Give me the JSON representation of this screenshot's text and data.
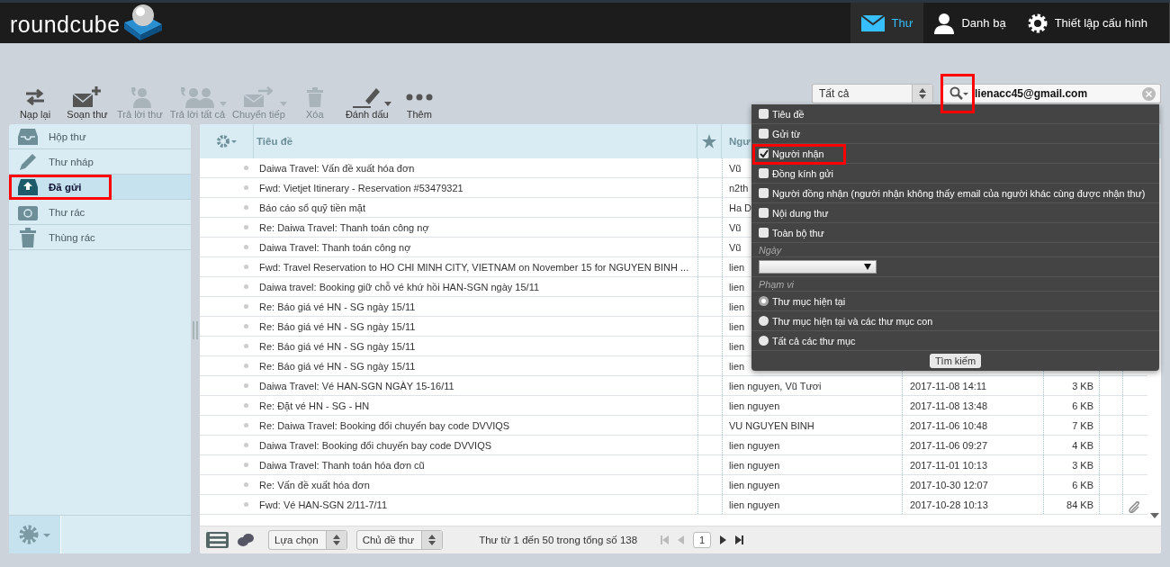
{
  "header": {
    "logo": "roundcube",
    "nav": [
      {
        "label": "Thư",
        "kind": "mail",
        "selected": true
      },
      {
        "label": "Danh bạ",
        "kind": "person",
        "selected": false
      },
      {
        "label": "Thiết lập cấu hình",
        "kind": "gear",
        "selected": false
      }
    ]
  },
  "toolbar": [
    {
      "label": "Nạp lại",
      "kind": "refresh",
      "disabled": false,
      "menu": false
    },
    {
      "label": "Soạn thư",
      "kind": "compose",
      "disabled": false,
      "menu": false
    },
    {
      "label": "Trả lời thư",
      "kind": "reply",
      "disabled": true,
      "menu": false
    },
    {
      "label": "Trả lời tất cả",
      "kind": "replyall",
      "disabled": true,
      "menu": true
    },
    {
      "label": "Chuyển tiếp",
      "kind": "forward",
      "disabled": true,
      "menu": true
    },
    {
      "label": "Xóa",
      "kind": "delete",
      "disabled": true,
      "menu": false
    },
    {
      "label": "Đánh dấu",
      "kind": "mark",
      "disabled": false,
      "menu": true
    },
    {
      "label": "Thêm",
      "kind": "more",
      "disabled": false,
      "menu": false
    }
  ],
  "filter": {
    "value": "Tất cả"
  },
  "search": {
    "value": "lienacc45@gmail.com",
    "highlighted": true
  },
  "folders": [
    {
      "label": "Hộp thư",
      "kind": "inbox",
      "selected": false,
      "highlighted": false
    },
    {
      "label": "Thư nháp",
      "kind": "drafts",
      "selected": false,
      "highlighted": false
    },
    {
      "label": "Đã gửi",
      "kind": "sent",
      "selected": true,
      "highlighted": true
    },
    {
      "label": "Thư rác",
      "kind": "junk",
      "selected": false,
      "highlighted": false
    },
    {
      "label": "Thùng rác",
      "kind": "trash",
      "selected": false,
      "highlighted": false
    }
  ],
  "table": {
    "columns": {
      "subject": "Tiêu đề",
      "sender": "Ngư"
    },
    "rows": [
      {
        "subject": "Daiwa Travel: Vấn đề xuất hóa đơn",
        "sender": "Vũ"
      },
      {
        "subject": "Fwd: Vietjet Itinerary - Reservation #53479321",
        "sender": "n2th"
      },
      {
        "subject": "Báo cáo sổ quỹ tiền mặt",
        "sender": "Ha D"
      },
      {
        "subject": "Re: Daiwa Travel: Thanh toán công nợ",
        "sender": "Vũ"
      },
      {
        "subject": "Daiwa Travel: Thanh toán công nợ",
        "sender": "Vũ"
      },
      {
        "subject": "Fwd: Travel Reservation to HO CHI MINH CITY, VIETNAM on November 15 for NGUYEN BINH ...",
        "sender": "lien"
      },
      {
        "subject": "Daiwa travel: Booking giữ chỗ vé khứ hồi HAN-SGN ngày 15/11",
        "sender": "lien"
      },
      {
        "subject": "Re: Báo giá vé HN - SG ngày 15/11",
        "sender": "lien"
      },
      {
        "subject": "Re: Báo giá vé HN - SG ngày 15/11",
        "sender": "lien"
      },
      {
        "subject": "Re: Báo giá vé HN - SG ngày 15/11",
        "sender": "lien"
      },
      {
        "subject": "Re: Báo giá vé HN - SG ngày 15/11",
        "sender": "lien"
      },
      {
        "subject": "Daiwa Travel: Vé HAN-SGN NGÀY 15-16/11",
        "sender": "lien nguyen, Vũ Tươi",
        "date": "2017-11-08 14:11",
        "size": "3 KB"
      },
      {
        "subject": "Re: Đặt vé HN - SG - HN",
        "sender": "lien nguyen",
        "date": "2017-11-08 13:48",
        "size": "6 KB"
      },
      {
        "subject": "Re: Daiwa Travel: Booking đổi chuyến bay code DVVIQS",
        "sender": "VU NGUYEN BINH",
        "date": "2017-11-06 10:48",
        "size": "7 KB"
      },
      {
        "subject": "Daiwa Travel: Booking đổi chuyến bay code DVVIQS",
        "sender": "lien nguyen",
        "date": "2017-11-06 09:27",
        "size": "4 KB"
      },
      {
        "subject": "Daiwa Travel: Thanh toán hóa đơn cũ",
        "sender": "lien nguyen",
        "date": "2017-11-01 10:13",
        "size": "3 KB"
      },
      {
        "subject": "Re: Vấn đề xuất hóa đơn",
        "sender": "lien nguyen",
        "date": "2017-10-30 12:07",
        "size": "6 KB"
      },
      {
        "subject": "Fwd: Vé HAN-SGN 2/11-7/11",
        "sender": "lien nguyen",
        "date": "2017-10-28 10:13",
        "size": "84 KB",
        "attachment": true
      }
    ]
  },
  "footer": {
    "select": "Lựa chọn",
    "threads": "Chủ đề thư",
    "count": "Thư từ 1 đến 50 trong tổng số 138",
    "page": "1"
  },
  "search_menu": {
    "options": [
      {
        "label": "Tiêu đề",
        "checked": false
      },
      {
        "label": "Gửi từ",
        "checked": false
      },
      {
        "label": "Người nhận",
        "checked": true,
        "highlighted": true
      },
      {
        "label": "Đồng kính gửi",
        "checked": false
      },
      {
        "label": "Người đồng nhận (người nhận không thấy email của người khác cùng được nhận thư)",
        "checked": false
      },
      {
        "label": "Nội dung thư",
        "checked": false
      },
      {
        "label": "Toàn bộ thư",
        "checked": false
      }
    ],
    "date_label": "Ngày",
    "scope_label": "Phạm vi",
    "scopes": [
      {
        "label": "Thư mục hiện tại",
        "selected": true
      },
      {
        "label": "Thư mục hiện tại và các thư mục con",
        "selected": false
      },
      {
        "label": "Tất cả các thư mục",
        "selected": false
      }
    ],
    "button": "Tìm kiếm"
  }
}
